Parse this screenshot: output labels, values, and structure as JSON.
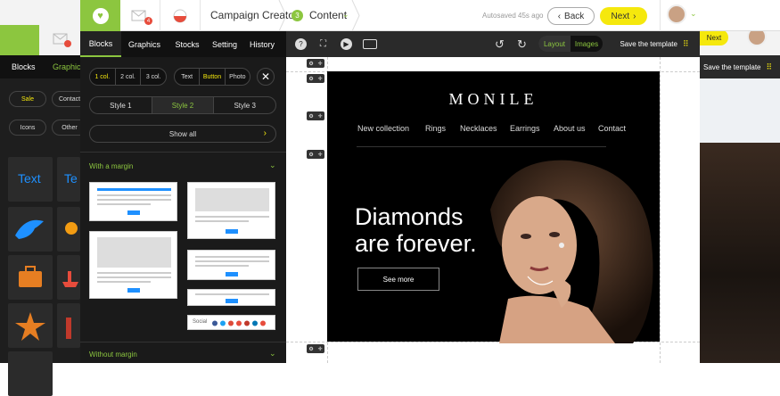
{
  "app": {
    "notification_count": "4",
    "breadcrumb_1": "Campaign Creator",
    "step_number": "3",
    "step_label": "Content",
    "autosave": "Autosaved 45s ago",
    "back_label": "Back",
    "next_label": "Next"
  },
  "panel": {
    "tabs": [
      "Blocks",
      "Graphics",
      "Stocks",
      "Setting",
      "History"
    ],
    "columns": [
      "1 col.",
      "2 col.",
      "3 col."
    ],
    "types": [
      "Text",
      "Button",
      "Photo"
    ],
    "styles": [
      "Style 1",
      "Style 2",
      "Style 3"
    ],
    "show_all": "Show all",
    "section_margin": "With a margin",
    "section_nomargin": "Without margin",
    "social_label": "Social"
  },
  "toolbar": {
    "view_layout": "Layout",
    "view_images": "Images",
    "save_template": "Save the template"
  },
  "email": {
    "brand": "MONILE",
    "nav": [
      "New collection",
      "Rings",
      "Necklaces",
      "Earrings",
      "About us",
      "Contact"
    ],
    "headline_1": "Diamonds",
    "headline_2": "are forever.",
    "cta": "See more"
  },
  "background": {
    "tabs": [
      "Blocks",
      "Graphics"
    ],
    "chips": [
      "Sale",
      "Contact",
      "Icons",
      "Other"
    ],
    "tile_text": "Text",
    "tile_text_partial": "Te",
    "next_partial": "Next",
    "save_template": "Save the template"
  },
  "colors": {
    "accent_green": "#8cc63f",
    "accent_yellow": "#f5e80d",
    "notification_red": "#e74c3c"
  }
}
